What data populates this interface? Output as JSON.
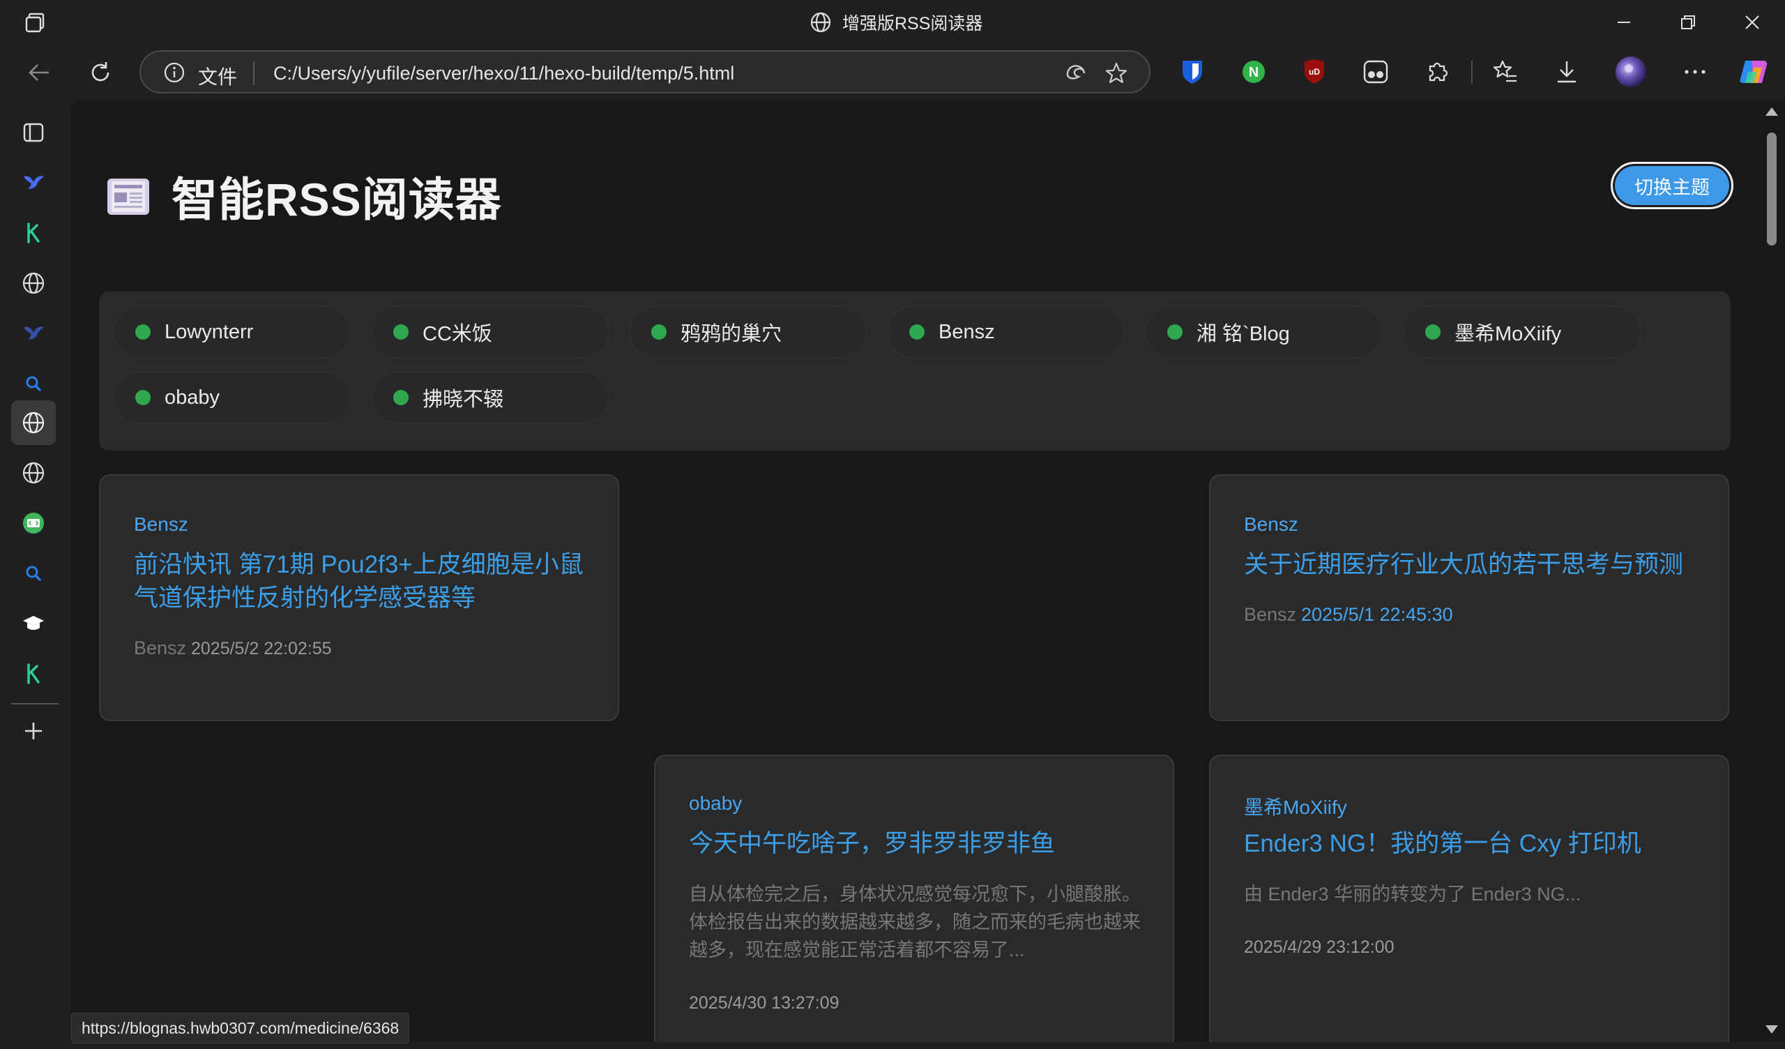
{
  "window": {
    "title": "增强版RSS阅读器"
  },
  "addressbar": {
    "scheme_label": "文件",
    "url": "C:/Users/y/yufile/server/hexo/11/hexo-build/temp/5.html"
  },
  "page": {
    "title": "智能RSS阅读器",
    "theme_button": "切换主题"
  },
  "sources": [
    {
      "name": "Lowynterr"
    },
    {
      "name": "CC米饭"
    },
    {
      "name": "鸦鸦的巢穴"
    },
    {
      "name": "Bensz"
    },
    {
      "name": "湘 铭`Blog"
    },
    {
      "name": "墨希MoXiify"
    },
    {
      "name": "obaby"
    },
    {
      "name": "拂晓不辍"
    }
  ],
  "articles": [
    {
      "source": "Bensz",
      "title": "前沿快讯 第71期 Pou2f3+上皮细胞是小鼠气道保护性反射的化学感受器等",
      "author": "Bensz",
      "date": "2025/5/2 22:02:55"
    },
    {
      "source": "Bensz",
      "title": "关于近期医疗行业大瓜的若干思考与预测",
      "author": "Bensz",
      "date": "2025/5/1 22:45:30"
    },
    {
      "source": "obaby",
      "title": "今天中午吃啥子，罗非罗非罗非鱼",
      "excerpt": "自从体检完之后，身体状况感觉每况愈下，小腿酸胀。体检报告出来的数据越来越多，随之而来的毛病也越来越多，现在感觉能正常活着都不容易了...",
      "date": "2025/4/30 13:27:09"
    },
    {
      "source": "墨希MoXiify",
      "title": "Ender3 NG！我的第一台 Cxy 打印机",
      "excerpt": "由 Ender3 华丽的转变为了 Ender3 NG...",
      "date": "2025/4/29 23:12:00"
    }
  ],
  "status_url": "https://blognas.hwb0307.com/medicine/6368",
  "colors": {
    "accent": "#3d9ee8",
    "status_dot": "#2fa84f",
    "background": "#181818",
    "card": "#2a2a2a"
  },
  "sidebar_icons": [
    "tab-actions-icon",
    "bird-icon",
    "k-app-icon",
    "globe-icon",
    "bird-icon",
    "search-icon",
    "globe-icon",
    "globe-icon",
    "code-icon",
    "search-icon",
    "graduation-cap-icon",
    "k-app-icon",
    "add-icon"
  ]
}
